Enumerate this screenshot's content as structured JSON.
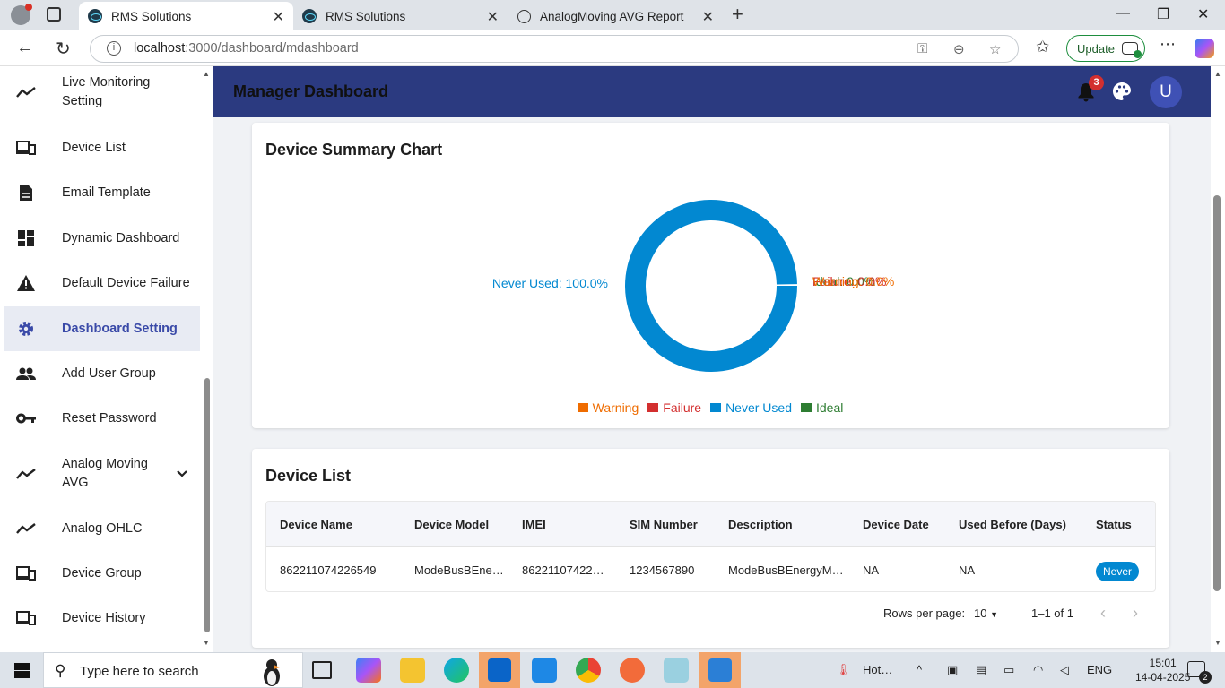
{
  "browser": {
    "tabs": [
      {
        "title": "RMS Solutions",
        "active": true
      },
      {
        "title": "RMS Solutions",
        "active": false
      },
      {
        "title": "AnalogMoving AVG Report",
        "active": false
      }
    ],
    "url_host": "localhost",
    "url_path": ":3000/dashboard/mdashboard",
    "update_label": "Update"
  },
  "sidebar": {
    "items": [
      {
        "label": "Live Monitoring Setting",
        "icon": "trending-up-icon"
      },
      {
        "label": "Device List",
        "icon": "devices-icon"
      },
      {
        "label": "Email Template",
        "icon": "document-icon"
      },
      {
        "label": "Dynamic Dashboard",
        "icon": "dashboard-icon"
      },
      {
        "label": "Default Device Failure",
        "icon": "warning-icon"
      },
      {
        "label": "Dashboard Setting",
        "icon": "gear-icon",
        "active": true
      },
      {
        "label": "Add User Group",
        "icon": "people-icon"
      },
      {
        "label": "Reset Password",
        "icon": "key-icon"
      },
      {
        "label": "Analog Moving AVG",
        "icon": "trending-up-icon",
        "expandable": true
      },
      {
        "label": "Analog OHLC",
        "icon": "trending-up-icon"
      },
      {
        "label": "Device Group",
        "icon": "devices-icon"
      },
      {
        "label": "Device History",
        "icon": "devices-icon"
      }
    ]
  },
  "header": {
    "title": "Manager Dashboard",
    "notification_count": "3",
    "avatar_letter": "U",
    "bar_color": "#2b3a80"
  },
  "summary_chart": {
    "heading": "Device Summary Chart"
  },
  "chart_data": {
    "type": "pie",
    "title": "Device Summary Chart",
    "donut": true,
    "slices": [
      {
        "label": "Warning",
        "value": 0.0,
        "color": "#ef6c00"
      },
      {
        "label": "Failure",
        "value": 0.0,
        "color": "#d32f2f"
      },
      {
        "label": "Never Used",
        "value": 100.0,
        "color": "#0288d1"
      },
      {
        "label": "Ideal",
        "value": 0.0,
        "color": "#2e7d32"
      }
    ],
    "data_labels": {
      "never_used": "Never Used: 100.0%",
      "ideal": "Ideal: 0.0%",
      "failure": "Failure: 0.0%",
      "warning": "Warning: 0.0%"
    },
    "legend": [
      "Warning",
      "Failure",
      "Never Used",
      "Ideal"
    ],
    "legend_position": "bottom"
  },
  "device_list": {
    "heading": "Device List",
    "columns": [
      "Device Name",
      "Device Model",
      "IMEI",
      "SIM Number",
      "Description",
      "Device Date",
      "Used Before (Days)",
      "Status"
    ],
    "rows": [
      {
        "device_name": "862211074226549",
        "device_model": "ModeBusBEne…",
        "imei": "86221107422…",
        "sim_number": "1234567890",
        "description": "ModeBusBEnergyM…",
        "device_date": "NA",
        "used_before": "NA",
        "status": "Never"
      }
    ],
    "pagination": {
      "rows_per_page_label": "Rows per page:",
      "rows_per_page": "10",
      "range": "1–1 of 1"
    }
  },
  "taskbar": {
    "search_placeholder": "Type here to search",
    "weather": "Hot…",
    "language": "ENG",
    "time": "15:01",
    "date": "14-04-2025",
    "notifications": "2"
  }
}
